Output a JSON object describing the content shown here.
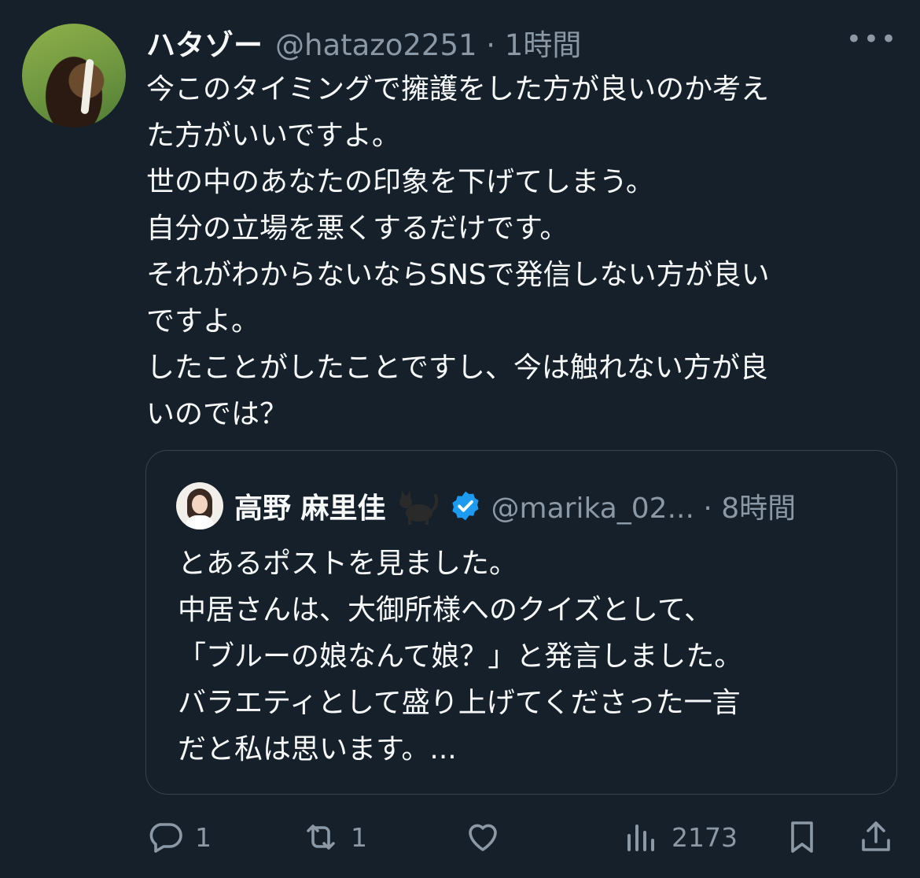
{
  "tweet": {
    "display_name": "ハタゾー",
    "handle_time": "@hatazo2251 · 1時間",
    "more": "•••",
    "lines": [
      "今このタイミングで擁護をした方が良いのか考え",
      "た方がいいですよ。",
      "世の中のあなたの印象を下げてしまう。",
      "自分の立場を悪くするだけです。",
      "それがわからないならSNSで発信しない方が良い",
      "ですよ。",
      "したことがしたことですし、今は触れない方が良",
      "いのでは？"
    ]
  },
  "quote": {
    "display_name": "高野 麻里佳",
    "handle_time": "@marika_02... · 8時間",
    "lines": [
      "とあるポストを見ました。",
      "中居さんは、大御所様へのクイズとして、",
      "「ブルーの娘なんて娘？」と発言しました。",
      "バラエティとして盛り上げてくださった一言",
      "だと私は思います。..."
    ]
  },
  "actions": {
    "reply_count": "1",
    "retweet_count": "1",
    "like_count": "",
    "views_count": "2173"
  },
  "colors": {
    "background": "#15202b",
    "text": "#f7f9f9",
    "secondary": "#8b98a5",
    "border": "#38444d",
    "verified": "#1d9bf0"
  }
}
